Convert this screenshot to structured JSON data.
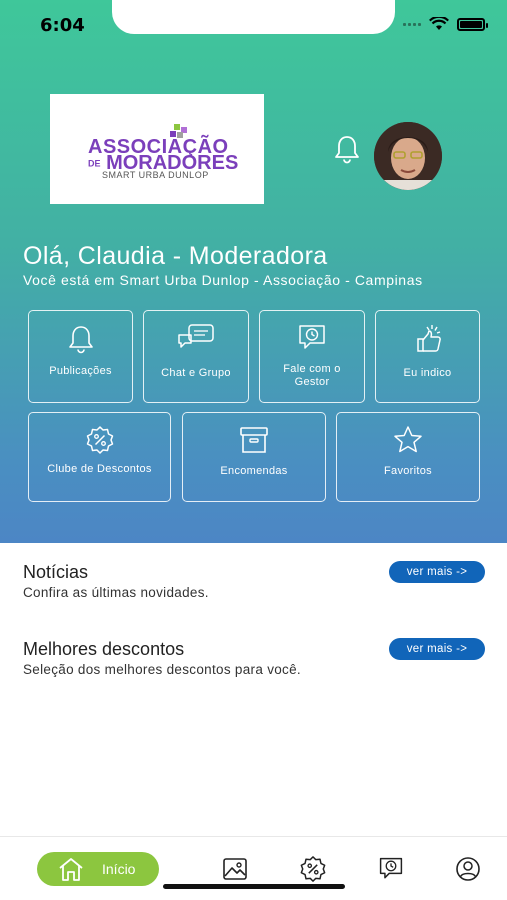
{
  "status_bar": {
    "time": "6:04"
  },
  "header": {
    "logo": {
      "line1": "ASSOCIAÇÃO",
      "line2_prefix": "DE",
      "line2": "MORADORES",
      "line3": "SMART URBA DUNLOP"
    },
    "greeting": "Olá, Claudia - Moderadora",
    "location": "Você está em Smart Urba Dunlop - Associação - Campinas"
  },
  "tiles_row1": [
    {
      "label": "Publicações",
      "icon": "bell-icon"
    },
    {
      "label": "Chat e Grupo",
      "icon": "chat-icon"
    },
    {
      "label": "Fale com o Gestor",
      "icon": "message-clock-icon"
    },
    {
      "label": "Eu indico",
      "icon": "thumbs-up-icon"
    }
  ],
  "tiles_row2": [
    {
      "label": "Clube de Descontos",
      "icon": "discount-badge-icon"
    },
    {
      "label": "Encomendas",
      "icon": "package-box-icon"
    },
    {
      "label": "Favoritos",
      "icon": "star-icon"
    }
  ],
  "sections": {
    "news": {
      "title": "Notícias",
      "subtitle": "Confira as últimas novidades.",
      "button": "ver mais ->"
    },
    "discounts": {
      "title": "Melhores descontos",
      "subtitle": "Seleção dos melhores descontos para você.",
      "button": "ver mais ->"
    }
  },
  "bottom_nav": {
    "home_label": "Início",
    "items": [
      "home-icon",
      "image-icon",
      "discount-badge-icon",
      "message-clock-icon",
      "profile-icon"
    ]
  },
  "colors": {
    "gradient_top": "#3fc79a",
    "gradient_bottom": "#4c86c5",
    "logo_purple": "#7b3fbb",
    "button_blue": "#1165b9",
    "nav_active_green": "#8cc63f"
  }
}
